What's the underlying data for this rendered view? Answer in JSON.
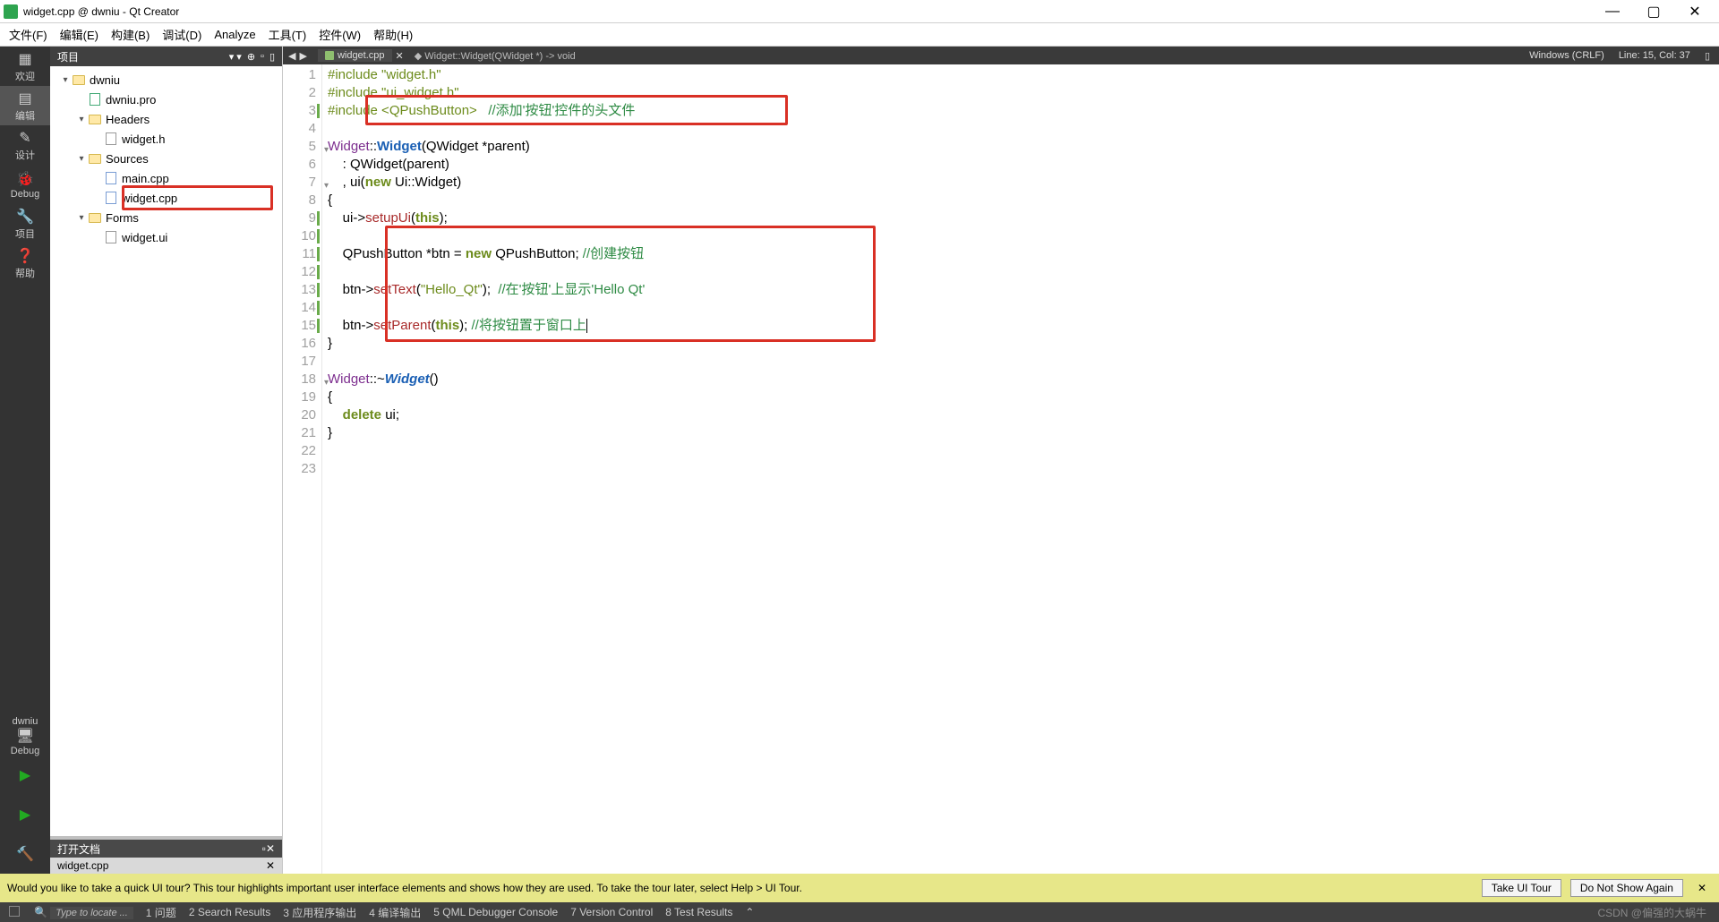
{
  "window": {
    "title": "widget.cpp @ dwniu - Qt Creator"
  },
  "menu": [
    "文件(F)",
    "编辑(E)",
    "构建(B)",
    "调试(D)",
    "Analyze",
    "工具(T)",
    "控件(W)",
    "帮助(H)"
  ],
  "leftbar": {
    "welcome": "欢迎",
    "edit": "编辑",
    "design": "设计",
    "debug": "Debug",
    "project": "项目",
    "help": "帮助",
    "kit": "dwniu",
    "debug2": "Debug"
  },
  "sidepanel": {
    "header": "项目",
    "tree": {
      "root": "dwniu",
      "pro": "dwniu.pro",
      "headers": "Headers",
      "widget_h": "widget.h",
      "sources": "Sources",
      "main_cpp": "main.cpp",
      "widget_cpp": "widget.cpp",
      "forms": "Forms",
      "widget_ui": "widget.ui"
    },
    "open_header": "打开文档",
    "open_item": "widget.cpp"
  },
  "editor": {
    "tab": "widget.cpp",
    "symbol": "Widget::Widget(QWidget *) -> void",
    "encoding": "Windows (CRLF)",
    "pos": "Line: 15, Col: 37"
  },
  "code": {
    "l1_a": "#include",
    "l1_b": " \"widget.h\"",
    "l2_a": "#include",
    "l2_b": " \"ui_widget.h\"",
    "l3_a": "#include",
    "l3_b": " <QPushButton>   ",
    "l3_c": "//添加'按钮'控件的头文件",
    "l5_a": "Widget",
    "l5_b": "::",
    "l5_c": "Widget",
    "l5_d": "(QWidget *parent)",
    "l6": "    : QWidget(parent)",
    "l7_a": "    , ui(",
    "l7_b": "new",
    "l7_c": " Ui::Widget)",
    "l8": "{",
    "l9_a": "    ui->",
    "l9_b": "setupUi",
    "l9_c": "(",
    "l9_d": "this",
    "l9_e": ");",
    "l11_a": "    QPushButton *btn = ",
    "l11_b": "new",
    "l11_c": " QPushButton; ",
    "l11_d": "//创建按钮",
    "l13_a": "    btn->",
    "l13_b": "setText",
    "l13_c": "(",
    "l13_d": "\"Hello_Qt\"",
    "l13_e": ");  ",
    "l13_f": "//在'按钮'上显示'Hello Qt'",
    "l15_a": "    btn->",
    "l15_b": "setParent",
    "l15_c": "(",
    "l15_d": "this",
    "l15_e": "); ",
    "l15_f": "//将按钮置于窗口上",
    "l16": "}",
    "l18_a": "Widget",
    "l18_b": "::~",
    "l18_c": "Widget",
    "l18_d": "()",
    "l19": "{",
    "l20_a": "    ",
    "l20_b": "delete",
    "l20_c": " ui;",
    "l21": "}"
  },
  "notify": {
    "text": "Would you like to take a quick UI tour? This tour highlights important user interface elements and shows how they are used. To take the tour later, select Help > UI Tour.",
    "btn1": "Take UI Tour",
    "btn2": "Do Not Show Again"
  },
  "status": {
    "locator": "Type to locate ...",
    "i1": "1 问题",
    "i2": "2 Search Results",
    "i3": "3 应用程序输出",
    "i4": "4 编译输出",
    "i5": "5 QML Debugger Console",
    "i7": "7 Version Control",
    "i8": "8 Test Results",
    "watermark": "CSDN @偏强的大蜗牛"
  }
}
